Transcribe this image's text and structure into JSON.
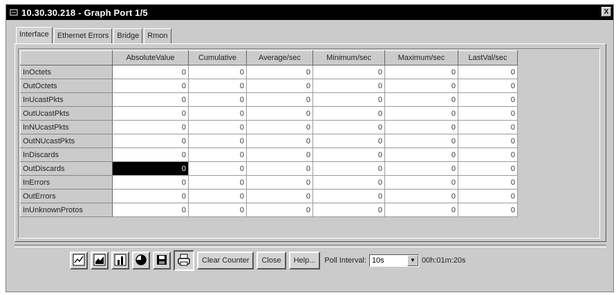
{
  "window": {
    "title": "10.30.30.218 - Graph Port 1/5",
    "title_icon": "app-icon",
    "close_label": "X"
  },
  "tabs": [
    {
      "label": "Interface",
      "active": true
    },
    {
      "label": "Ethernet Errors",
      "active": false
    },
    {
      "label": "Bridge",
      "active": false
    },
    {
      "label": "Rmon",
      "active": false
    }
  ],
  "table": {
    "columns": [
      "",
      "AbsoluteValue",
      "Cumulative",
      "Average/sec",
      "Minimum/sec",
      "Maximum/sec",
      "LastVal/sec"
    ],
    "rows": [
      {
        "label": "InOctets",
        "values": [
          "0",
          "0",
          "0",
          "0",
          "0",
          "0"
        ]
      },
      {
        "label": "OutOctets",
        "values": [
          "0",
          "0",
          "0",
          "0",
          "0",
          "0"
        ]
      },
      {
        "label": "InUcastPkts",
        "values": [
          "0",
          "0",
          "0",
          "0",
          "0",
          "0"
        ]
      },
      {
        "label": "OutUcastPkts",
        "values": [
          "0",
          "0",
          "0",
          "0",
          "0",
          "0"
        ]
      },
      {
        "label": "InNUcastPkts",
        "values": [
          "0",
          "0",
          "0",
          "0",
          "0",
          "0"
        ]
      },
      {
        "label": "OutNUcastPkts",
        "values": [
          "0",
          "0",
          "0",
          "0",
          "0",
          "0"
        ]
      },
      {
        "label": "InDiscards",
        "values": [
          "0",
          "0",
          "0",
          "0",
          "0",
          "0"
        ]
      },
      {
        "label": "OutDiscards",
        "values": [
          "0",
          "0",
          "0",
          "0",
          "0",
          "0"
        ]
      },
      {
        "label": "InErrors",
        "values": [
          "0",
          "0",
          "0",
          "0",
          "0",
          "0"
        ]
      },
      {
        "label": "OutErrors",
        "values": [
          "0",
          "0",
          "0",
          "0",
          "0",
          "0"
        ]
      },
      {
        "label": "InUnknownProtos",
        "values": [
          "0",
          "0",
          "0",
          "0",
          "0",
          "0"
        ]
      }
    ],
    "selected_row": "OutDiscards",
    "selected_column": "AbsoluteValue"
  },
  "toolbar": {
    "icon_buttons": [
      {
        "name": "line-graph-icon"
      },
      {
        "name": "area-graph-icon"
      },
      {
        "name": "bar-graph-icon"
      },
      {
        "name": "pie-chart-icon"
      },
      {
        "name": "save-icon"
      },
      {
        "name": "print-icon"
      }
    ],
    "clear_counter_label": "Clear Counter",
    "close_label": "Close",
    "help_label": "Help...",
    "poll_interval_label": "Poll Interval:",
    "poll_interval_value": "10s",
    "elapsed_time": "00h:01m:20s"
  },
  "colors": {
    "window_bg": "#cbcbcb",
    "titlebar_bg": "#000000",
    "selection_bg": "#000000",
    "cell_bg": "#ffffff"
  }
}
